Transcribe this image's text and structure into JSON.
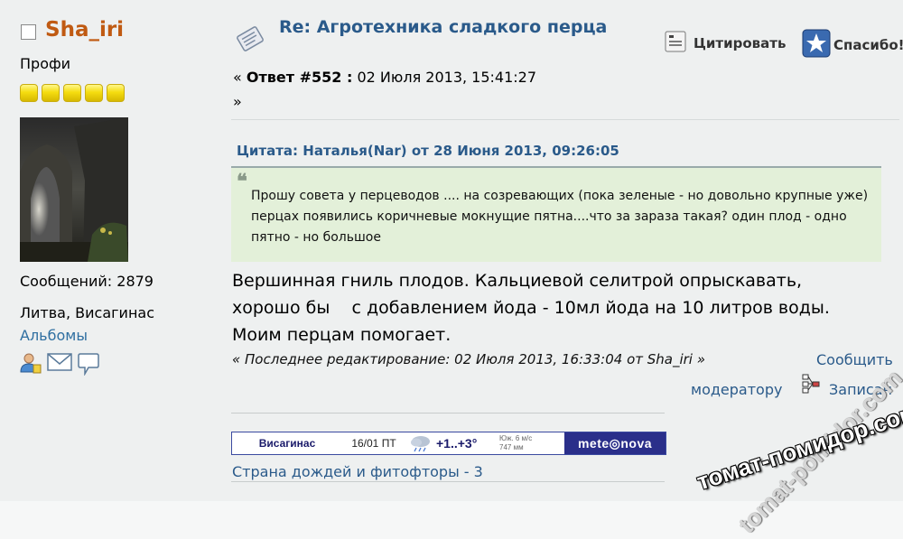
{
  "profile": {
    "username": "Sha_iri",
    "rank": "Профи",
    "star_count": 5,
    "posts_label": "Сообщений: 2879",
    "location": "Литва, Висагинас",
    "albums_link": "Альбомы"
  },
  "post": {
    "title": "Re: Агротехника сладкого перца",
    "reply_prefix": "«",
    "reply_label": "Ответ #552 :",
    "reply_date": "02 Июля 2013, 15:41:27",
    "reply_suffix": "»",
    "quote_button": "Цитировать",
    "thanks_button": "Спасибо!",
    "quote_header": "Цитата: Наталья(Nar) от 28 Июня 2013, 09:26:05",
    "quote_mark": "❝",
    "quote_text": "Прошу совета у перцеводов .... на созревающих (пока зеленые - но довольно крупные уже) перцах появились коричневые мокнущие пятна....что за зараза такая?  один плод - одно пятно - но большое",
    "body_lines": [
      "Вершинная гниль плодов.  Кальциевой селитрой опрыскавать,",
      "хорошо бы    с добавлением йода - 10мл йода на 10 литров воды.",
      "Моим перцам помогает."
    ],
    "last_edited": "« Последнее редактирование: 02 Июля 2013, 16:33:04 от Sha_iri »",
    "report_link": "Сообщить",
    "moderator_link": "модератору",
    "ip_logged": "Записан"
  },
  "weather": {
    "city": "Висагинас",
    "date": "16/01  ПТ",
    "temp": "+1..+3°",
    "wind": "Юж. 6 м/с",
    "pressure": "747 мм",
    "brand": "mete◎nova"
  },
  "signature": "Страна дождей и фитофторы - 3",
  "watermark": {
    "main": "томат-помидор.com",
    "overlay": "tomat-pomidor.com"
  },
  "colors": {
    "username": "#c05a12",
    "link": "#2a5a8a",
    "quote_bg": "#e3f0d9",
    "post_bg": "#eef0f0",
    "star": "#f5dd10",
    "weather_brand": "#2a2f8a"
  }
}
